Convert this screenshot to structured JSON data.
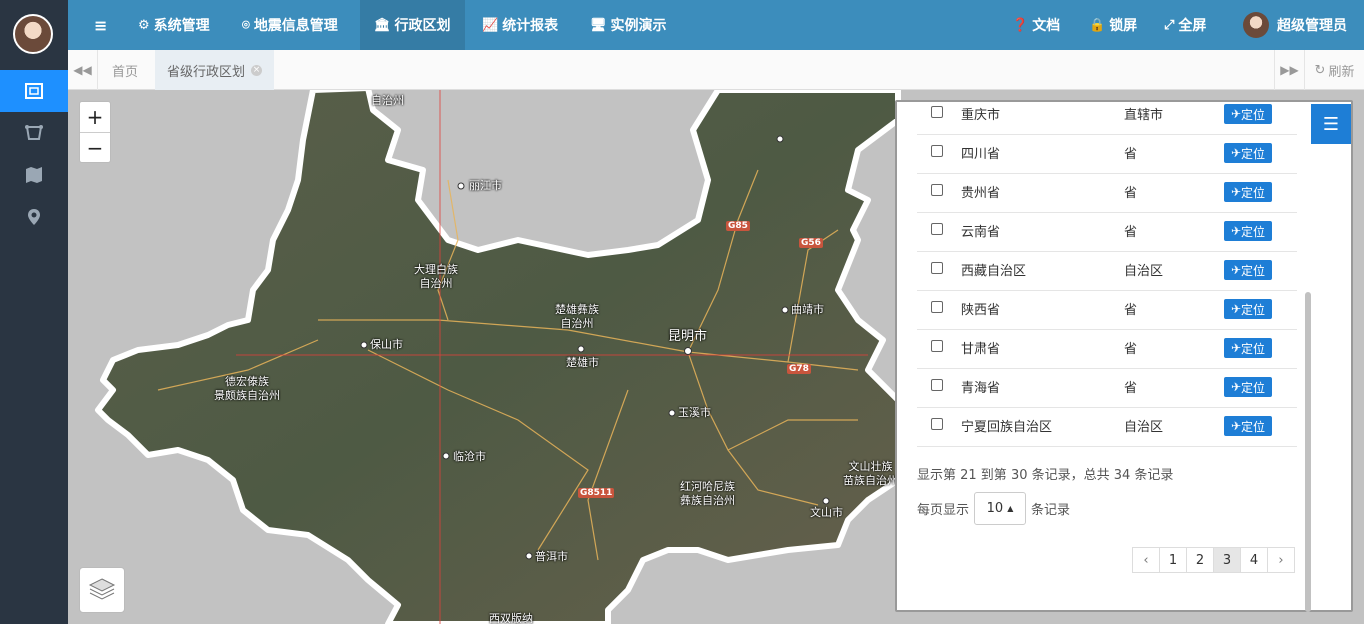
{
  "header": {
    "menu_icon": "hamburger-icon",
    "nav": [
      {
        "label": "系统管理",
        "icon": "gear-icon"
      },
      {
        "label": "地震信息管理",
        "icon": "map-pin-icon"
      },
      {
        "label": "行政区划",
        "icon": "bank-icon"
      },
      {
        "label": "统计报表",
        "icon": "area-chart-icon"
      },
      {
        "label": "实例演示",
        "icon": "monitor-icon"
      }
    ],
    "right": [
      {
        "label": "文档",
        "icon": "question-icon"
      },
      {
        "label": "锁屏",
        "icon": "lock-icon"
      },
      {
        "label": "全屏",
        "icon": "expand-icon"
      }
    ],
    "user_name": "超级管理员"
  },
  "tabs": {
    "home": "首页",
    "current": "省级行政区划",
    "refresh": "刷新"
  },
  "map": {
    "labels": {
      "lijiang": "丽江市",
      "dali": "大理白族\n自治州",
      "chuxiong_pref": "楚雄彝族\n自治州",
      "kunming": "昆明市",
      "qujing": "曲靖市",
      "baoshan": "保山市",
      "chuxiong": "楚雄市",
      "dehong": "德宏傣族\n景颇族自治州",
      "yuxi": "玉溪市",
      "lincang": "临沧市",
      "honghe": "红河哈尼族\n彝族自治州",
      "wenshan_pref": "文山壮族\n苗族自治州",
      "wenshan": "文山市",
      "puer": "普洱市",
      "xishuangbanna": "西双版纳",
      "top_pref": "自治州"
    },
    "highways": [
      "G85",
      "G56",
      "G78",
      "G8511"
    ]
  },
  "table": {
    "locate_label": "定位",
    "rows": [
      {
        "name": "重庆市",
        "type": "直辖市"
      },
      {
        "name": "四川省",
        "type": "省"
      },
      {
        "name": "贵州省",
        "type": "省"
      },
      {
        "name": "云南省",
        "type": "省"
      },
      {
        "name": "西藏自治区",
        "type": "自治区"
      },
      {
        "name": "陕西省",
        "type": "省"
      },
      {
        "name": "甘肃省",
        "type": "省"
      },
      {
        "name": "青海省",
        "type": "省"
      },
      {
        "name": "宁夏回族自治区",
        "type": "自治区"
      }
    ]
  },
  "pagination": {
    "info": "显示第 21 到第 30 条记录，总共 34 条记录",
    "per_page_prefix": "每页显示",
    "per_page_value": "10",
    "per_page_suffix": "条记录",
    "prev": "‹",
    "pages": [
      "1",
      "2",
      "3",
      "4"
    ],
    "next": "›",
    "active_page": "3"
  }
}
